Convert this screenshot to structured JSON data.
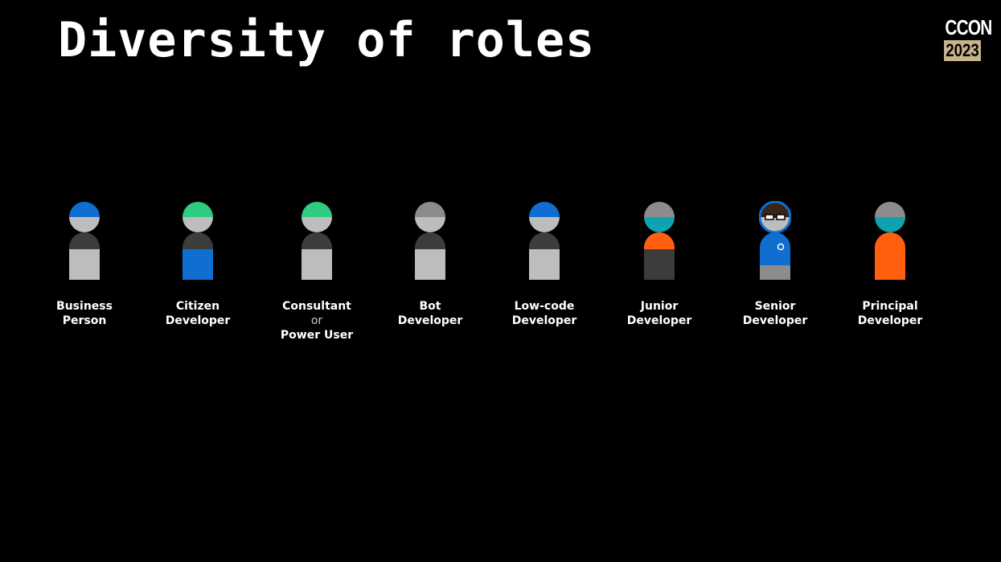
{
  "title": "Diversity of roles",
  "logo": {
    "name": "CCON",
    "year": "2023"
  },
  "colors": {
    "background": "#000000",
    "blue": "#0f6fd0",
    "green": "#2ecc80",
    "grey_cap": "#8c8c8c",
    "teal": "#0fa3b1",
    "orange": "#ff5f0f",
    "face": "#bdbdbd",
    "dark": "#3c3c3c",
    "light_body": "#bdbdbd",
    "logo_bg": "#c8b48c"
  },
  "roles": [
    {
      "line1": "Business",
      "line2": "Person",
      "cap": "#0f6fd0",
      "neck": "#3c3c3c",
      "body": "#bdbdbd",
      "icon": "business-person-icon"
    },
    {
      "line1": "Citizen",
      "line2": "Developer",
      "cap": "#2ecc80",
      "neck": "#3c3c3c",
      "body": "#0f6fd0",
      "icon": "citizen-developer-icon"
    },
    {
      "line1": "Consultant",
      "connector": "or",
      "line2": "Power User",
      "cap": "#2ecc80",
      "neck": "#3c3c3c",
      "body": "#bdbdbd",
      "icon": "consultant-icon"
    },
    {
      "line1": "Bot",
      "line2": "Developer",
      "cap": "#8c8c8c",
      "neck": "#3c3c3c",
      "body": "#bdbdbd",
      "icon": "bot-developer-icon"
    },
    {
      "line1": "Low-code",
      "line2": "Developer",
      "cap": "#0f6fd0",
      "neck": "#3c3c3c",
      "body": "#bdbdbd",
      "icon": "low-code-developer-icon"
    },
    {
      "line1": "Junior",
      "line2": "Developer",
      "cap": "#8c8c8c",
      "chin": "#0fa3b1",
      "neck": "#ff5f0f",
      "body": "#3c3c3c",
      "icon": "junior-developer-icon"
    },
    {
      "line1": "Senior",
      "line2": "Developer",
      "cap": "#3a2418",
      "neck": "#0f6fd0",
      "body": "#0f6fd0",
      "legs": "#8c8c8c",
      "outline": "#0f6fd0",
      "glasses": true,
      "icon": "senior-developer-icon"
    },
    {
      "line1": "Principal",
      "line2": "Developer",
      "cap": "#8c8c8c",
      "chin": "#0fa3b1",
      "neck": "#ff5f0f",
      "body": "#ff5f0f",
      "icon": "principal-developer-icon"
    }
  ]
}
